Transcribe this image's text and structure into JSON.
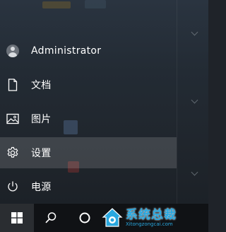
{
  "start_menu": {
    "items": [
      {
        "label": "Administrator",
        "icon": "user-avatar-icon"
      },
      {
        "label": "文档",
        "icon": "document-icon"
      },
      {
        "label": "图片",
        "icon": "pictures-icon"
      },
      {
        "label": "设置",
        "icon": "gear-icon",
        "hovered": true
      },
      {
        "label": "电源",
        "icon": "power-icon"
      }
    ]
  },
  "taskbar": {
    "buttons": [
      {
        "name": "start",
        "icon": "windows-logo-icon"
      },
      {
        "name": "search",
        "icon": "search-icon"
      },
      {
        "name": "task-view",
        "icon": "cortana-circle-icon"
      }
    ]
  },
  "watermark": {
    "title": "系统总裁",
    "url": "Xitongzongcai.com"
  },
  "colors": {
    "accent": "#29a8e0",
    "taskbar": "#101215",
    "hover": "#3a3e44"
  }
}
